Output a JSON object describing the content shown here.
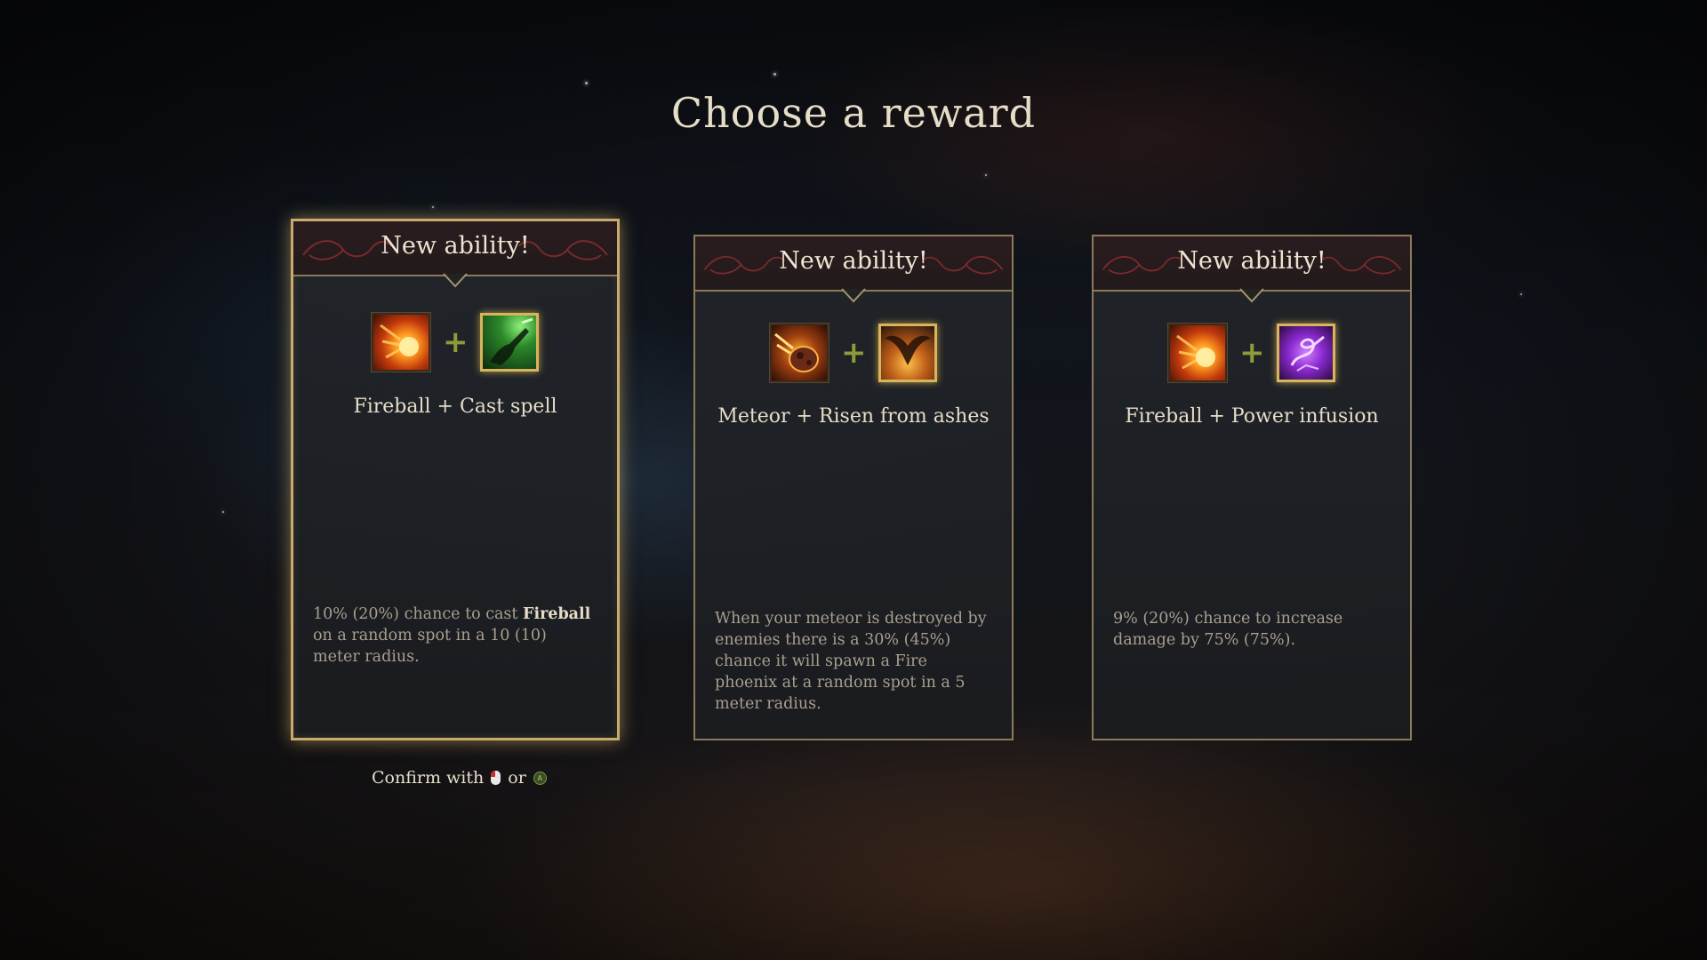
{
  "screen": {
    "title": "Choose a reward"
  },
  "cards": [
    {
      "header": "New ability!",
      "selected": true,
      "icons": [
        "fireball-icon",
        "cast-spell-icon"
      ],
      "combo": "Fireball + Cast spell",
      "description_parts": [
        "10% (20%) chance to cast ",
        "Fireball",
        " on a random spot in a 10 (10) meter radius."
      ]
    },
    {
      "header": "New ability!",
      "selected": false,
      "icons": [
        "meteor-icon",
        "risen-from-ashes-icon"
      ],
      "combo": "Meteor + Risen from ashes",
      "description": "When your meteor is destroyed by enemies there is a 30% (45%) chance it will spawn a Fire phoenix at a random spot in a 5 meter radius."
    },
    {
      "header": "New ability!",
      "selected": false,
      "icons": [
        "fireball-icon",
        "power-infusion-icon"
      ],
      "combo": "Fireball + Power infusion",
      "description": "9% (20%) chance to increase damage by 75% (75%)."
    }
  ],
  "footer": {
    "confirm_label": "Confirm with",
    "or_label": "or",
    "gamepad_button": "A"
  },
  "colors": {
    "gold_border": "#c9ab6e",
    "card_border": "#8c7a58",
    "text_light": "#e6ddc8",
    "text_muted": "#a89f8e",
    "plus_green": "#8f9a3a"
  }
}
